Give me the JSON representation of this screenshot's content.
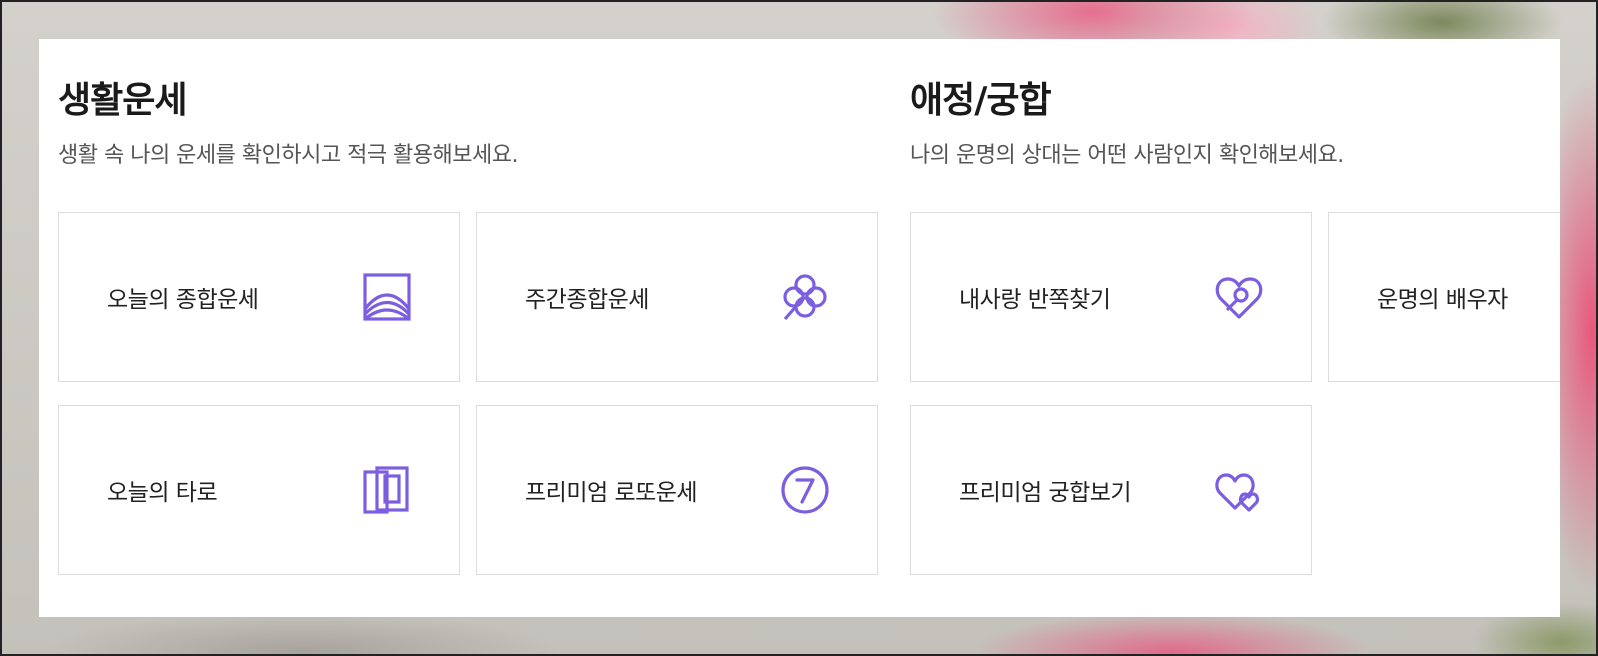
{
  "sections": {
    "life": {
      "title": "생활운세",
      "description": "생활 속 나의 운세를 확인하시고 적극 활용해보세요.",
      "cards": [
        {
          "label": "오늘의 종합운세",
          "icon": "sunrise-frame-icon"
        },
        {
          "label": "주간종합운세",
          "icon": "clover-icon"
        },
        {
          "label": "오늘의 타로",
          "icon": "tarot-cards-icon"
        },
        {
          "label": "프리미엄 로또운세",
          "icon": "number-seven-circle-icon"
        }
      ]
    },
    "love": {
      "title": "애정/궁합",
      "description": "나의 운명의 상대는 어떤 사람인지 확인해보세요.",
      "cards": [
        {
          "label": "내사랑 반쪽찾기",
          "icon": "heart-search-icon"
        },
        {
          "label": "운명의 배우자",
          "icon": ""
        },
        {
          "label": "프리미엄 궁합보기",
          "icon": "double-heart-icon"
        }
      ]
    }
  },
  "colors": {
    "accent": "#7b5fe0",
    "title": "#1a1a1a",
    "description": "#555555",
    "card_border": "#dcdcdc"
  }
}
